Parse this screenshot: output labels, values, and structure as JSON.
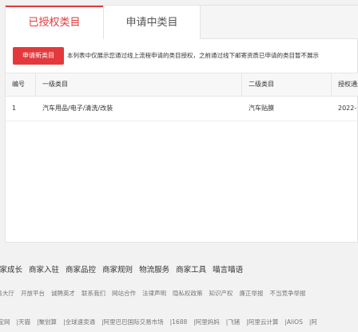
{
  "tabs": [
    {
      "label": "已授权类目"
    },
    {
      "label": "申请中类目"
    }
  ],
  "notice": {
    "button_label": "申请新类目",
    "text": "本列表中仅展示您通过线上流程申请的类目授权，之前通过线下邮寄资质已申请的类目暂不展示"
  },
  "table": {
    "headers": [
      "编号",
      "一级类目",
      "二级类目",
      "授权通过时间"
    ],
    "rows": [
      {
        "id": "1",
        "level1": "汽车用品/电子/清洗/改装",
        "level2": "汽车贴膜",
        "date": "2022-"
      }
    ]
  },
  "footer": {
    "primary_links": [
      "商家成长",
      "商家入驻",
      "商家品控",
      "商家规则",
      "物流服务",
      "商家工具",
      "喵言喵语"
    ],
    "secondary_links": [
      "服务大厅",
      "开放平台",
      "诚聘英才",
      "联系我们",
      "网站合作",
      "法律声明",
      "隐私权政策",
      "知识产权",
      "廉正举报",
      "不当竞争举报"
    ],
    "tertiary_links": [
      "淘宝网",
      "天猫",
      "聚划算",
      "全球速卖通",
      "阿里巴巴国际交易市场",
      "1688",
      "阿里妈妈",
      "飞猪",
      "阿里云计算",
      "AliOS",
      "阿"
    ]
  }
}
